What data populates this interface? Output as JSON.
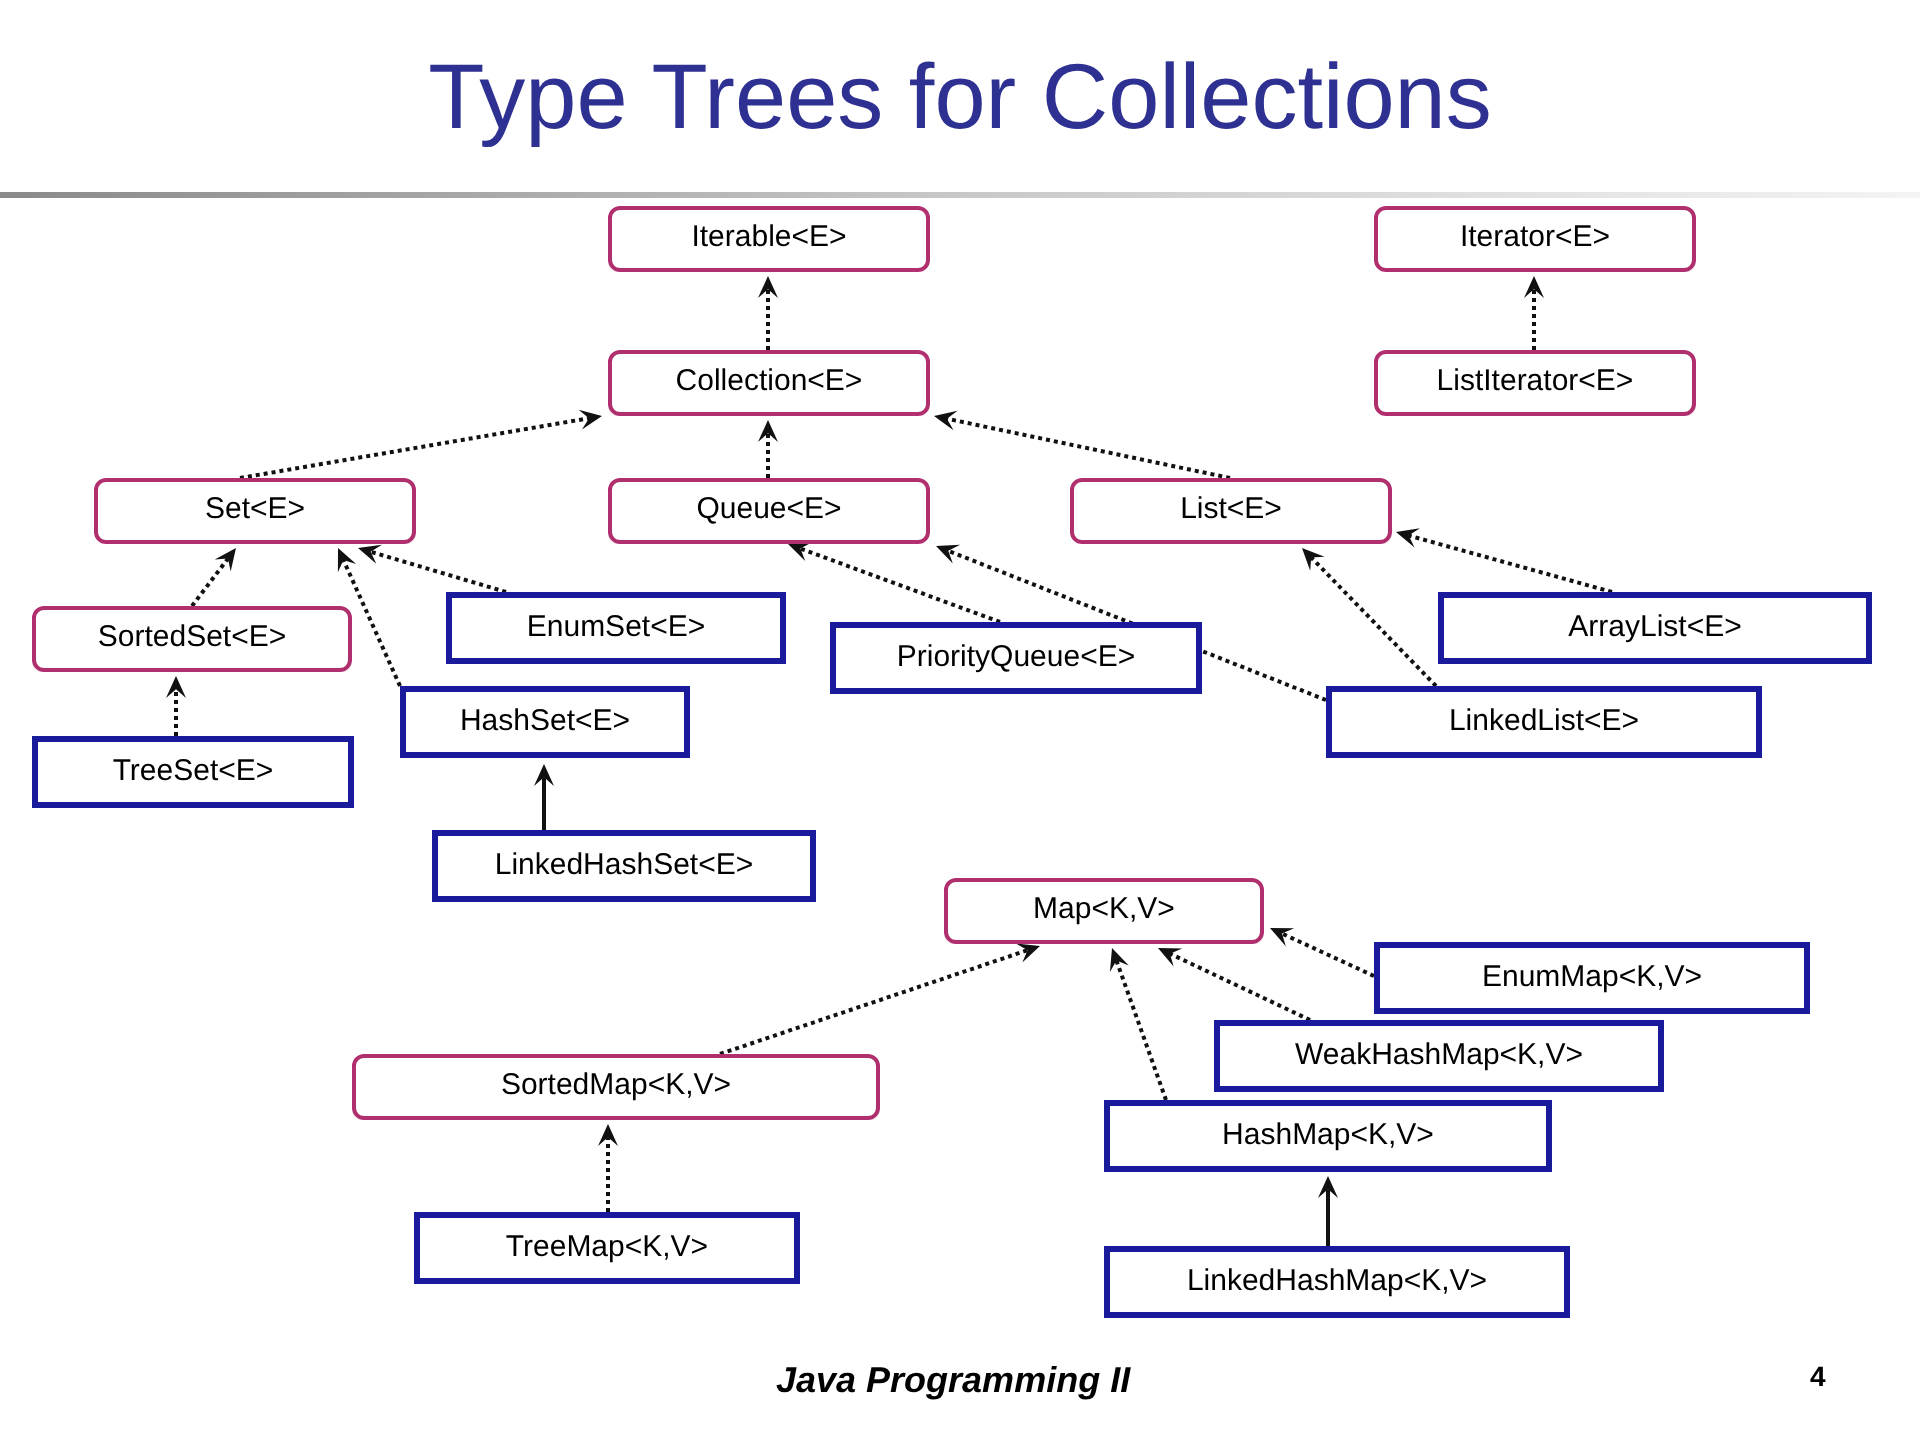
{
  "title": "Type Trees for Collections",
  "diagram": {
    "nodes": [
      {
        "label": "Iterable<E>",
        "kind": "interface"
      },
      {
        "label": "Iterator<E>",
        "kind": "interface"
      },
      {
        "label": "Collection<E>",
        "kind": "interface"
      },
      {
        "label": "ListIterator<E>",
        "kind": "interface"
      },
      {
        "label": "Set<E>",
        "kind": "interface"
      },
      {
        "label": "Queue<E>",
        "kind": "interface"
      },
      {
        "label": "List<E>",
        "kind": "interface"
      },
      {
        "label": "SortedSet<E>",
        "kind": "interface"
      },
      {
        "label": "EnumSet<E>",
        "kind": "class"
      },
      {
        "label": "PriorityQueue<E>",
        "kind": "class"
      },
      {
        "label": "ArrayList<E>",
        "kind": "class"
      },
      {
        "label": "HashSet<E>",
        "kind": "class"
      },
      {
        "label": "LinkedList<E>",
        "kind": "class"
      },
      {
        "label": "TreeSet<E>",
        "kind": "class"
      },
      {
        "label": "LinkedHashSet<E>",
        "kind": "class"
      },
      {
        "label": "Map<K,V>",
        "kind": "interface"
      },
      {
        "label": "EnumMap<K,V>",
        "kind": "class"
      },
      {
        "label": "WeakHashMap<K,V>",
        "kind": "class"
      },
      {
        "label": "SortedMap<K,V>",
        "kind": "interface"
      },
      {
        "label": "HashMap<K,V>",
        "kind": "class"
      },
      {
        "label": "TreeMap<K,V>",
        "kind": "class"
      },
      {
        "label": "LinkedHashMap<K,V>",
        "kind": "class"
      }
    ],
    "edges": [
      {
        "kind": "dotted"
      },
      {
        "kind": "dotted"
      },
      {
        "kind": "dotted"
      },
      {
        "kind": "dotted"
      },
      {
        "kind": "dotted"
      },
      {
        "kind": "dotted"
      },
      {
        "kind": "dotted"
      },
      {
        "kind": "dotted"
      },
      {
        "kind": "dotted"
      },
      {
        "kind": "dotted"
      },
      {
        "kind": "dotted"
      },
      {
        "kind": "dotted"
      },
      {
        "kind": "dotted"
      },
      {
        "kind": "solid"
      },
      {
        "kind": "dotted"
      },
      {
        "kind": "dotted"
      },
      {
        "kind": "dotted"
      },
      {
        "kind": "dotted"
      },
      {
        "kind": "dotted"
      },
      {
        "kind": "solid"
      }
    ]
  },
  "footer": {
    "course": "Java Programming II",
    "page": "4"
  }
}
